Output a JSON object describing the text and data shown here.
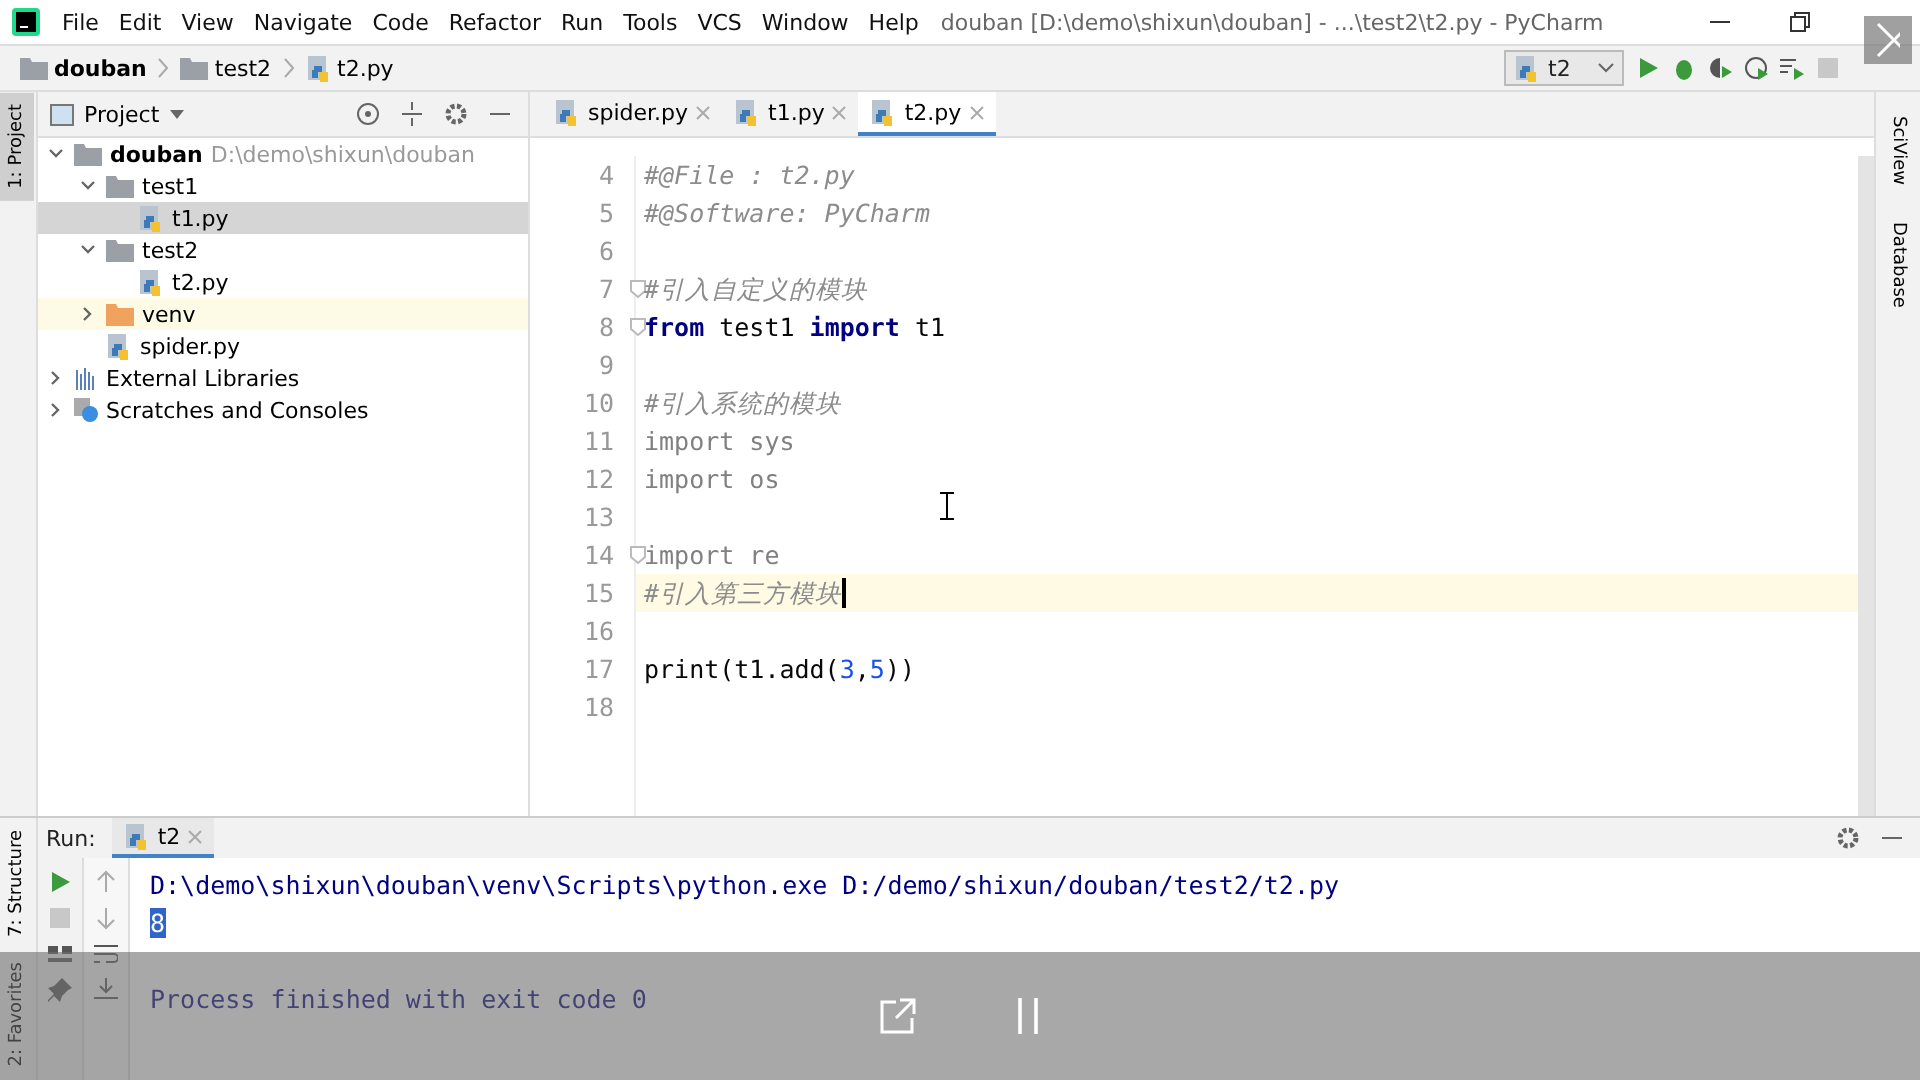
{
  "menu": [
    "File",
    "Edit",
    "View",
    "Navigate",
    "Code",
    "Refactor",
    "Run",
    "Tools",
    "VCS",
    "Window",
    "Help"
  ],
  "window": {
    "title": "douban [D:\\demo\\shixun\\douban] - ...\\test2\\t2.py - PyCharm"
  },
  "breadcrumbs": [
    {
      "label": "douban",
      "kind": "project"
    },
    {
      "label": "test2",
      "kind": "folder"
    },
    {
      "label": "t2.py",
      "kind": "python"
    }
  ],
  "run_config": {
    "value": "t2"
  },
  "left_stripe": [
    {
      "label": "1: Project",
      "selected": true
    },
    {
      "label": "7: Structure",
      "selected": false
    },
    {
      "label": "2: Favorites",
      "selected": false
    }
  ],
  "right_stripe": [
    {
      "label": "SciView"
    },
    {
      "label": "Database"
    }
  ],
  "project_panel": {
    "title": "Project",
    "tree": [
      {
        "label": "douban",
        "hint": "D:\\demo\\shixun\\douban",
        "kind": "project",
        "expanded": true,
        "selected": false,
        "children": [
          {
            "label": "test1",
            "kind": "folder",
            "expanded": true,
            "selected": false,
            "children": [
              {
                "label": "t1.py",
                "kind": "python",
                "selected": true
              }
            ]
          },
          {
            "label": "test2",
            "kind": "folder",
            "expanded": true,
            "selected": false,
            "children": [
              {
                "label": "t2.py",
                "kind": "python",
                "selected": false
              }
            ]
          },
          {
            "label": "venv",
            "kind": "excluded",
            "expanded": false,
            "selected": false
          },
          {
            "label": "spider.py",
            "kind": "python",
            "selected": false
          }
        ]
      },
      {
        "label": "External Libraries",
        "kind": "library",
        "expanded": false,
        "selected": false
      },
      {
        "label": "Scratches and Consoles",
        "kind": "scratches",
        "expanded": false,
        "selected": false
      }
    ]
  },
  "editor_tabs": [
    {
      "label": "spider.py",
      "selected": false
    },
    {
      "label": "t1.py",
      "selected": false
    },
    {
      "label": "t2.py",
      "selected": true
    }
  ],
  "code_lines": [
    {
      "number": "4",
      "current": false,
      "fold": false,
      "tokens": [
        {
          "text": "#@File : t2.py",
          "kind": "comment"
        }
      ]
    },
    {
      "number": "5",
      "current": false,
      "fold": false,
      "tokens": [
        {
          "text": "#@Software: PyCharm",
          "kind": "comment"
        }
      ]
    },
    {
      "number": "6",
      "current": false,
      "fold": false
    },
    {
      "number": "7",
      "current": false,
      "fold": true,
      "tokens": [
        {
          "text": "#引入自定义的模块",
          "kind": "comment"
        }
      ]
    },
    {
      "number": "8",
      "current": false,
      "fold": true,
      "tokens": [
        {
          "text": "from",
          "kind": "keyword"
        },
        {
          "text": " test1 ",
          "kind": "plain"
        },
        {
          "text": "import",
          "kind": "keyword"
        },
        {
          "text": " t1",
          "kind": "plain"
        }
      ]
    },
    {
      "number": "9",
      "current": false,
      "fold": false
    },
    {
      "number": "10",
      "current": false,
      "fold": false,
      "tokens": [
        {
          "text": "#引入系统的模块",
          "kind": "comment"
        }
      ]
    },
    {
      "number": "11",
      "current": false,
      "fold": false,
      "tokens": [
        {
          "text": "import",
          "kind": "unused"
        },
        {
          "text": " sys",
          "kind": "unused"
        }
      ]
    },
    {
      "number": "12",
      "current": false,
      "fold": false,
      "tokens": [
        {
          "text": "import",
          "kind": "unused"
        },
        {
          "text": " os",
          "kind": "unused"
        }
      ]
    },
    {
      "number": "13",
      "current": false,
      "fold": false
    },
    {
      "number": "14",
      "current": false,
      "fold": true,
      "tokens": [
        {
          "text": "import",
          "kind": "unused"
        },
        {
          "text": " re",
          "kind": "unused"
        }
      ]
    },
    {
      "number": "15",
      "current": true,
      "fold": false,
      "tokens": [
        {
          "text": "#引入第三方模块",
          "kind": "comment"
        }
      ]
    },
    {
      "number": "16",
      "current": false,
      "fold": false
    },
    {
      "number": "17",
      "current": false,
      "fold": false,
      "tokens": [
        {
          "text": "print(t1.add(",
          "kind": "plain"
        },
        {
          "text": "3",
          "kind": "number"
        },
        {
          "text": ",",
          "kind": "plain"
        },
        {
          "text": "5",
          "kind": "number"
        },
        {
          "text": "))",
          "kind": "plain"
        }
      ]
    },
    {
      "number": "18",
      "current": false,
      "fold": false
    }
  ],
  "run_panel": {
    "label": "Run:",
    "tab": {
      "label": "t2",
      "selected": true
    },
    "output": [
      {
        "text": "D:\\demo\\shixun\\douban\\venv\\Scripts\\python.exe D:/demo/shixun/douban/test2/t2.py",
        "kind": "command",
        "selected": false
      },
      {
        "text": "8",
        "kind": "result",
        "selected": true
      },
      {
        "text": "Process finished with exit code 0",
        "kind": "exit",
        "selected": false
      }
    ]
  }
}
